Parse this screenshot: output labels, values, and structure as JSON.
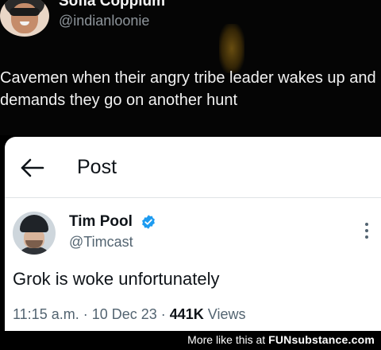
{
  "top_tweet": {
    "author_name": "Sofia Copplum",
    "author_handle": "@indianloonie",
    "text": "Cavemen when their angry tribe leader wakes up and demands they go on another hunt"
  },
  "embedded_post": {
    "header_title": "Post",
    "back_icon": "arrow-left-icon",
    "author_name": "Tim Pool",
    "verified_icon": "verified-badge-icon",
    "author_handle": "@Timcast",
    "text": "Grok is woke unfortunately",
    "time": "11:15 a.m. · 10 Dec 23 · ",
    "views_count": "441K",
    "views_label": " Views",
    "more_icon": "more-vertical-icon"
  },
  "footer": {
    "prefix": "More like this at ",
    "brand": "FUNsubstance.com"
  },
  "colors": {
    "verified_blue": "#1d9bf0",
    "text_dark": "#0f1419",
    "text_muted": "#536471"
  }
}
